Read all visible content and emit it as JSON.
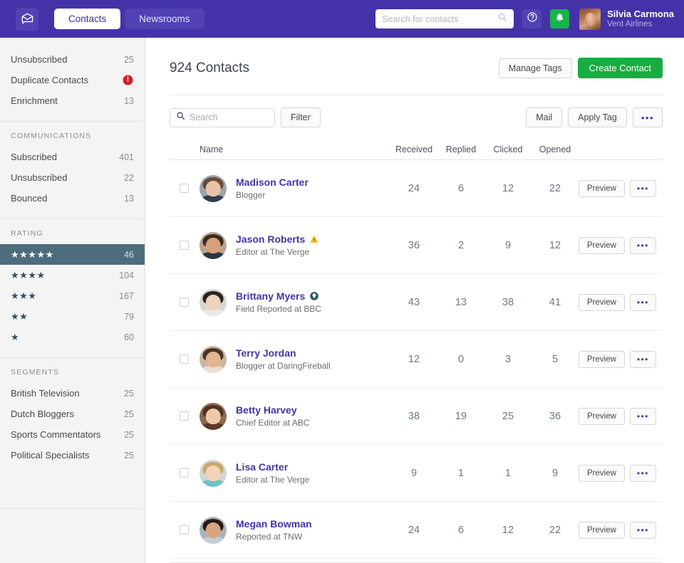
{
  "topbar": {
    "logo_icon": "envelope-chat-icon",
    "tabs": [
      {
        "label": "Contacts",
        "active": true
      },
      {
        "label": "Newsrooms",
        "active": false
      }
    ],
    "search": {
      "placeholder": "Search for contacts",
      "value": "",
      "icon": "search-icon"
    },
    "help_icon": "question-circle-icon",
    "bell_icon": "bell-icon",
    "user": {
      "name": "Silvia Carmona",
      "org": "Vent Airlines",
      "avatar": "user-avatar"
    },
    "brand_color": "#4433a8",
    "bell_color": "#19b24b"
  },
  "sidebar": {
    "top_items": [
      {
        "label": "Unsubscribed",
        "count": "25",
        "badge": null
      },
      {
        "label": "Duplicate Contacts",
        "count": null,
        "badge": "alert-exclamation-icon"
      },
      {
        "label": "Enrichment",
        "count": "13",
        "badge": null
      }
    ],
    "communications": {
      "title": "Communications",
      "items": [
        {
          "label": "Subscribed",
          "count": "401"
        },
        {
          "label": "Unsubscribed",
          "count": "22"
        },
        {
          "label": "Bounced",
          "count": "13"
        }
      ]
    },
    "rating": {
      "title": "Rating",
      "items": [
        {
          "stars": "★★★★★",
          "count": "46",
          "selected": true
        },
        {
          "stars": "★★★★",
          "count": "104",
          "selected": false
        },
        {
          "stars": "★★★",
          "count": "167",
          "selected": false
        },
        {
          "stars": "★★",
          "count": "79",
          "selected": false
        },
        {
          "stars": "★",
          "count": "60",
          "selected": false
        }
      ],
      "selected_color": "#4d6d7c"
    },
    "segments": {
      "title": "Segments",
      "items": [
        {
          "label": "British Television",
          "count": "25"
        },
        {
          "label": "Dutch Bloggers",
          "count": "25"
        },
        {
          "label": "Sports Commentators",
          "count": "25"
        },
        {
          "label": "Political Specialists",
          "count": "25"
        }
      ]
    }
  },
  "main": {
    "title": "924 Contacts",
    "manage_tags_label": "Manage Tags",
    "create_contact_label": "Create Contact",
    "create_contact_color": "#17ad42",
    "toolbar": {
      "search_placeholder": "Search",
      "search_value": "",
      "search_icon": "search-icon",
      "filter_label": "Filter",
      "mail_label": "Mail",
      "apply_tag_label": "Apply Tag",
      "more_label": "•••"
    },
    "table": {
      "headers": {
        "name": "Name",
        "received": "Received",
        "replied": "Replied",
        "clicked": "Clicked",
        "opened": "Opened"
      },
      "row_actions": {
        "preview_label": "Preview",
        "more_label": "•••"
      },
      "rows": [
        {
          "name": "Madison Carter",
          "subtitle": "Blogger",
          "badge": null,
          "received": "24",
          "replied": "6",
          "clicked": "12",
          "opened": "22"
        },
        {
          "name": "Jason Roberts",
          "subtitle": "Editor at The Verge",
          "badge": "warning-triangle-icon",
          "received": "36",
          "replied": "2",
          "clicked": "9",
          "opened": "12"
        },
        {
          "name": "Brittany Myers",
          "subtitle": "Field Reported at BBC",
          "badge": "info-circle-icon",
          "received": "43",
          "replied": "13",
          "clicked": "38",
          "opened": "41"
        },
        {
          "name": "Terry Jordan",
          "subtitle": "Blogger at DaringFireball",
          "badge": null,
          "received": "12",
          "replied": "0",
          "clicked": "3",
          "opened": "5"
        },
        {
          "name": "Betty Harvey",
          "subtitle": "Chief Editor at ABC",
          "badge": null,
          "received": "38",
          "replied": "19",
          "clicked": "25",
          "opened": "36"
        },
        {
          "name": "Lisa Carter",
          "subtitle": "Editor at The Verge",
          "badge": null,
          "received": "9",
          "replied": "1",
          "clicked": "1",
          "opened": "9"
        },
        {
          "name": "Megan Bowman",
          "subtitle": "Reported at TNW",
          "badge": null,
          "received": "24",
          "replied": "6",
          "clicked": "12",
          "opened": "22"
        }
      ]
    }
  },
  "avatar_palettes": [
    {
      "hair": "#6b4a33",
      "face": "#e8c3a6",
      "body": "#2f3d50",
      "bg": "#9aa4ab"
    },
    {
      "hair": "#3a2b20",
      "face": "#d7a07a",
      "body": "#2b3440",
      "bg": "#b9a48c"
    },
    {
      "hair": "#2a2320",
      "face": "#edd3bb",
      "body": "#e8e8e8",
      "bg": "#d8d5d0"
    },
    {
      "hair": "#4a3426",
      "face": "#e3b68f",
      "body": "#e9ded2",
      "bg": "#c9b79f"
    },
    {
      "hair": "#503224",
      "face": "#efc9a8",
      "body": "#5c3a2a",
      "bg": "#8d6a4f"
    },
    {
      "hair": "#c9a86a",
      "face": "#f2d3b8",
      "body": "#6fc2c6",
      "bg": "#cfd6d8"
    },
    {
      "hair": "#241c18",
      "face": "#d7a581",
      "body": "#c2cdd2",
      "bg": "#aab4b8"
    }
  ]
}
